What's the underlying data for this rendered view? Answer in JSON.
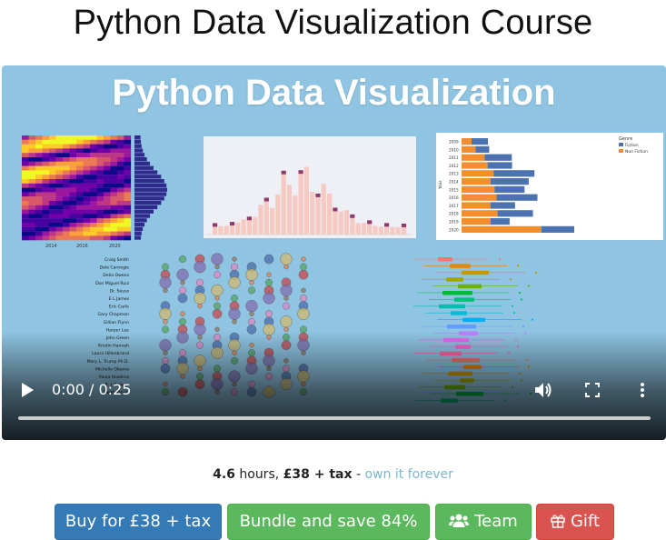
{
  "page": {
    "title": "Python Data Visualization Course"
  },
  "video": {
    "thumbnail_title": "Python Data Visualization",
    "time_display": "0:00 / 0:25",
    "controls": [
      "play-icon",
      "volume-icon",
      "fullscreen-icon",
      "more-options-icon"
    ],
    "bar_chart": {
      "legend_title": "Genre",
      "legend_items": [
        "Fiction",
        "Non Fiction"
      ],
      "ylabel": "Year",
      "years": [
        "2009",
        "2010",
        "2011",
        "2012",
        "2013",
        "2014",
        "2015",
        "2016",
        "2017",
        "2018",
        "2019",
        "2020"
      ]
    },
    "dot_chart": {
      "names": [
        "Craig Smith",
        "Dale Carnegie",
        "Delia Owens",
        "Don Miguel Ruiz",
        "Dr. Seuss",
        "E L James",
        "Eric Carle",
        "Gary Chapman",
        "Gillian Flynn",
        "Harper Lee",
        "John Green",
        "Kristin Hannah",
        "Laura Hillenbrand",
        "Mary L. Trump Ph.D.",
        "Michelle Obama",
        "Paula Hawkins",
        "R. J. Palacio",
        "Sarah Young"
      ]
    },
    "heatmap": {
      "xticks": [
        "2014",
        "2016",
        "2020"
      ]
    }
  },
  "info": {
    "hours": "4.6",
    "hours_label": "hours,",
    "price": "£38 + tax",
    "separator": "-",
    "own_link": "own it forever"
  },
  "buttons": {
    "buy": "Buy for £38 + tax",
    "bundle": "Bundle and save 84%",
    "team": "Team",
    "gift": "Gift"
  },
  "colors": {
    "thumb_bg": "#8fc5e3",
    "buy": "#337ab7",
    "bundle": "#5cb85c",
    "gift": "#d9534f",
    "link": "#7ab6cc"
  }
}
